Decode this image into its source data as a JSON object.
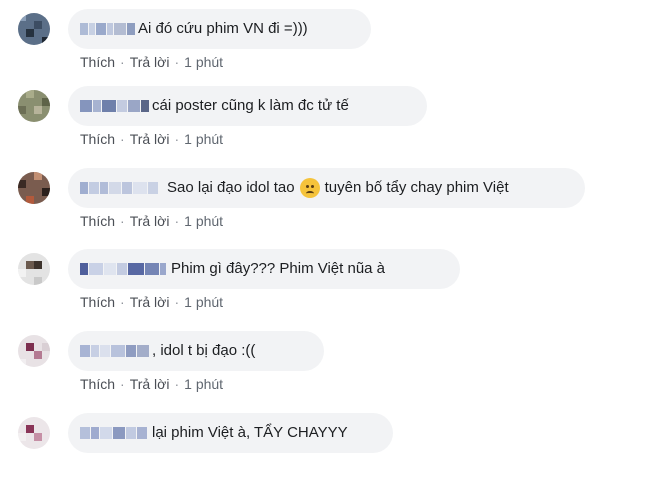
{
  "comments": [
    {
      "text": "Ai đó cứu phim VN đi =)))",
      "like": "Thích",
      "reply": "Trả lời",
      "time": "1 phút"
    },
    {
      "text": "cái poster cũng k làm đc tử tế",
      "like": "Thích",
      "reply": "Trả lời",
      "time": "1 phút"
    },
    {
      "text": "Sao lại đạo idol tao",
      "text_after_emoji": "tuyên bố tẩy chay phim Việt",
      "emoji": "sad-face-icon",
      "like": "Thích",
      "reply": "Trả lời",
      "time": "1 phút"
    },
    {
      "text": "Phim gì đây??? Phim Việt nũa à",
      "like": "Thích",
      "reply": "Trả lời",
      "time": "1 phút"
    },
    {
      "text": ", idol t bị đạo :((",
      "like": "Thích",
      "reply": "Trả lời",
      "time": "1 phút"
    },
    {
      "text": "lại phim Việt à, TẨY CHAYYY",
      "like": "Thích",
      "reply": "Trả lời",
      "time": ""
    }
  ],
  "colors": {
    "bubble": "#f2f3f5",
    "action_text": "#606770",
    "blur_name": "#7f8fb5"
  }
}
